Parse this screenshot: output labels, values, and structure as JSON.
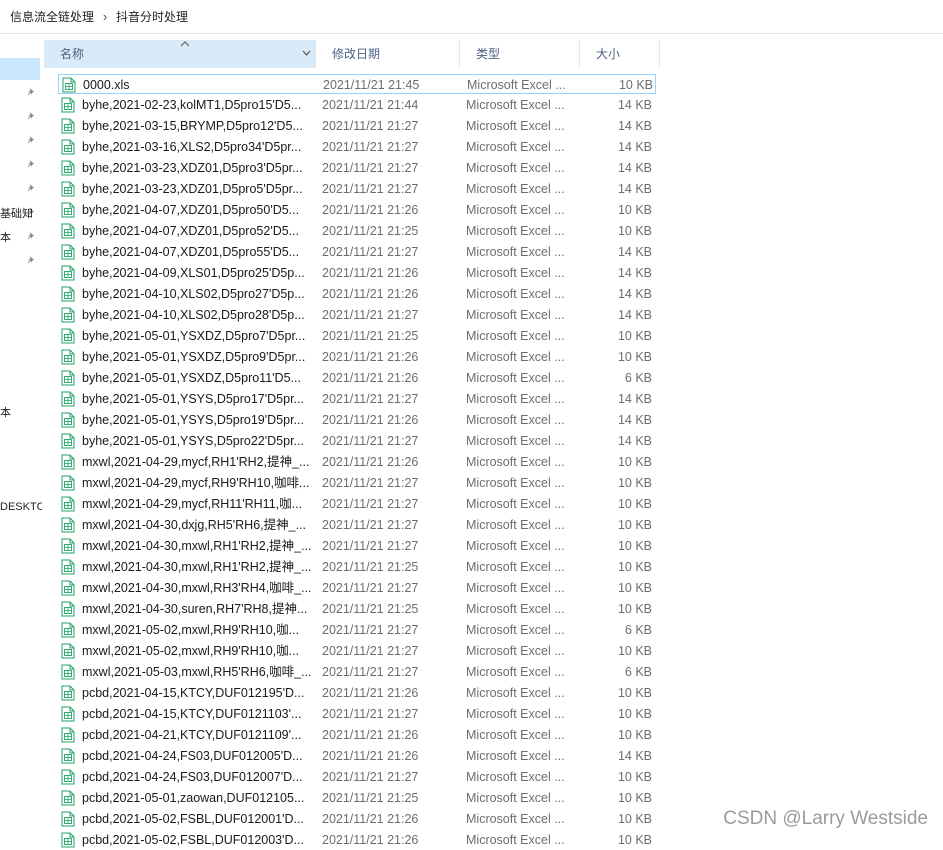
{
  "breadcrumb": [
    "信息流全链处理",
    "抖音分时处理"
  ],
  "sidebar": {
    "fragments": [
      "基础知",
      "本",
      "本",
      "DESKTC"
    ]
  },
  "columns": {
    "name": "名称",
    "date": "修改日期",
    "type": "类型",
    "size": "大小"
  },
  "files": [
    {
      "name": "0000.xls",
      "date": "2021/11/21 21:45",
      "type": "Microsoft Excel ...",
      "size": "10 KB"
    },
    {
      "name": "byhe,2021-02-23,kolMT1,D5pro15'D5...",
      "date": "2021/11/21 21:44",
      "type": "Microsoft Excel ...",
      "size": "14 KB"
    },
    {
      "name": "byhe,2021-03-15,BRYMP,D5pro12'D5...",
      "date": "2021/11/21 21:27",
      "type": "Microsoft Excel ...",
      "size": "14 KB"
    },
    {
      "name": "byhe,2021-03-16,XLS2,D5pro34'D5pr...",
      "date": "2021/11/21 21:27",
      "type": "Microsoft Excel ...",
      "size": "14 KB"
    },
    {
      "name": "byhe,2021-03-23,XDZ01,D5pro3'D5pr...",
      "date": "2021/11/21 21:27",
      "type": "Microsoft Excel ...",
      "size": "14 KB"
    },
    {
      "name": "byhe,2021-03-23,XDZ01,D5pro5'D5pr...",
      "date": "2021/11/21 21:27",
      "type": "Microsoft Excel ...",
      "size": "14 KB"
    },
    {
      "name": "byhe,2021-04-07,XDZ01,D5pro50'D5...",
      "date": "2021/11/21 21:26",
      "type": "Microsoft Excel ...",
      "size": "10 KB"
    },
    {
      "name": "byhe,2021-04-07,XDZ01,D5pro52'D5...",
      "date": "2021/11/21 21:25",
      "type": "Microsoft Excel ...",
      "size": "10 KB"
    },
    {
      "name": "byhe,2021-04-07,XDZ01,D5pro55'D5...",
      "date": "2021/11/21 21:27",
      "type": "Microsoft Excel ...",
      "size": "14 KB"
    },
    {
      "name": "byhe,2021-04-09,XLS01,D5pro25'D5p...",
      "date": "2021/11/21 21:26",
      "type": "Microsoft Excel ...",
      "size": "14 KB"
    },
    {
      "name": "byhe,2021-04-10,XLS02,D5pro27'D5p...",
      "date": "2021/11/21 21:26",
      "type": "Microsoft Excel ...",
      "size": "14 KB"
    },
    {
      "name": "byhe,2021-04-10,XLS02,D5pro28'D5p...",
      "date": "2021/11/21 21:27",
      "type": "Microsoft Excel ...",
      "size": "14 KB"
    },
    {
      "name": "byhe,2021-05-01,YSXDZ,D5pro7'D5pr...",
      "date": "2021/11/21 21:25",
      "type": "Microsoft Excel ...",
      "size": "10 KB"
    },
    {
      "name": "byhe,2021-05-01,YSXDZ,D5pro9'D5pr...",
      "date": "2021/11/21 21:26",
      "type": "Microsoft Excel ...",
      "size": "10 KB"
    },
    {
      "name": "byhe,2021-05-01,YSXDZ,D5pro11'D5...",
      "date": "2021/11/21 21:26",
      "type": "Microsoft Excel ...",
      "size": "6 KB"
    },
    {
      "name": "byhe,2021-05-01,YSYS,D5pro17'D5pr...",
      "date": "2021/11/21 21:27",
      "type": "Microsoft Excel ...",
      "size": "14 KB"
    },
    {
      "name": "byhe,2021-05-01,YSYS,D5pro19'D5pr...",
      "date": "2021/11/21 21:26",
      "type": "Microsoft Excel ...",
      "size": "14 KB"
    },
    {
      "name": "byhe,2021-05-01,YSYS,D5pro22'D5pr...",
      "date": "2021/11/21 21:27",
      "type": "Microsoft Excel ...",
      "size": "14 KB"
    },
    {
      "name": "mxwl,2021-04-29,mycf,RH1'RH2,提神_...",
      "date": "2021/11/21 21:26",
      "type": "Microsoft Excel ...",
      "size": "10 KB"
    },
    {
      "name": "mxwl,2021-04-29,mycf,RH9'RH10,咖啡...",
      "date": "2021/11/21 21:27",
      "type": "Microsoft Excel ...",
      "size": "10 KB"
    },
    {
      "name": "mxwl,2021-04-29,mycf,RH11'RH11,咖...",
      "date": "2021/11/21 21:27",
      "type": "Microsoft Excel ...",
      "size": "10 KB"
    },
    {
      "name": "mxwl,2021-04-30,dxjg,RH5'RH6,提神_...",
      "date": "2021/11/21 21:27",
      "type": "Microsoft Excel ...",
      "size": "10 KB"
    },
    {
      "name": "mxwl,2021-04-30,mxwl,RH1'RH2,提神_...",
      "date": "2021/11/21 21:27",
      "type": "Microsoft Excel ...",
      "size": "10 KB"
    },
    {
      "name": "mxwl,2021-04-30,mxwl,RH1'RH2,提神_...",
      "date": "2021/11/21 21:25",
      "type": "Microsoft Excel ...",
      "size": "10 KB"
    },
    {
      "name": "mxwl,2021-04-30,mxwl,RH3'RH4,咖啡_...",
      "date": "2021/11/21 21:27",
      "type": "Microsoft Excel ...",
      "size": "10 KB"
    },
    {
      "name": "mxwl,2021-04-30,suren,RH7'RH8,提神...",
      "date": "2021/11/21 21:25",
      "type": "Microsoft Excel ...",
      "size": "10 KB"
    },
    {
      "name": "mxwl,2021-05-02,mxwl,RH9'RH10,咖...",
      "date": "2021/11/21 21:27",
      "type": "Microsoft Excel ...",
      "size": "6 KB"
    },
    {
      "name": "mxwl,2021-05-02,mxwl,RH9'RH10,咖...",
      "date": "2021/11/21 21:27",
      "type": "Microsoft Excel ...",
      "size": "10 KB"
    },
    {
      "name": "mxwl,2021-05-03,mxwl,RH5'RH6,咖啡_...",
      "date": "2021/11/21 21:27",
      "type": "Microsoft Excel ...",
      "size": "6 KB"
    },
    {
      "name": "pcbd,2021-04-15,KTCY,DUF012195'D...",
      "date": "2021/11/21 21:26",
      "type": "Microsoft Excel ...",
      "size": "10 KB"
    },
    {
      "name": "pcbd,2021-04-15,KTCY,DUF0121103'...",
      "date": "2021/11/21 21:27",
      "type": "Microsoft Excel ...",
      "size": "10 KB"
    },
    {
      "name": "pcbd,2021-04-21,KTCY,DUF0121109'...",
      "date": "2021/11/21 21:26",
      "type": "Microsoft Excel ...",
      "size": "10 KB"
    },
    {
      "name": "pcbd,2021-04-24,FS03,DUF012005'D...",
      "date": "2021/11/21 21:26",
      "type": "Microsoft Excel ...",
      "size": "14 KB"
    },
    {
      "name": "pcbd,2021-04-24,FS03,DUF012007'D...",
      "date": "2021/11/21 21:27",
      "type": "Microsoft Excel ...",
      "size": "10 KB"
    },
    {
      "name": "pcbd,2021-05-01,zaowan,DUF012105...",
      "date": "2021/11/21 21:25",
      "type": "Microsoft Excel ...",
      "size": "10 KB"
    },
    {
      "name": "pcbd,2021-05-02,FSBL,DUF012001'D...",
      "date": "2021/11/21 21:26",
      "type": "Microsoft Excel ...",
      "size": "10 KB"
    },
    {
      "name": "pcbd,2021-05-02,FSBL,DUF012003'D...",
      "date": "2021/11/21 21:26",
      "type": "Microsoft Excel ...",
      "size": "10 KB"
    }
  ],
  "watermark": "CSDN @Larry Westside",
  "colors": {
    "selection": "#cce8ff",
    "header_sorted": "#d9ebf9",
    "focus_border": "#99d1ff",
    "excel_green": "#21a366"
  },
  "icons": {
    "file": "excel-file-icon",
    "pin": "pin-icon",
    "sort": "sort-ascending-icon"
  }
}
